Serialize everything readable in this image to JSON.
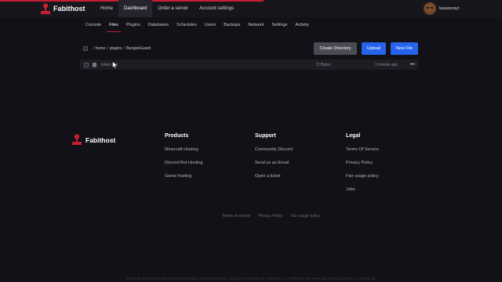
{
  "brand": {
    "name": "Fabithost"
  },
  "topnav": {
    "items": [
      {
        "label": "Home"
      },
      {
        "label": "Dashboard"
      },
      {
        "label": "Order a server"
      },
      {
        "label": "Account settings"
      }
    ],
    "active": "Dashboard"
  },
  "user": {
    "name": "kasaisorayt"
  },
  "subnav": {
    "items": [
      {
        "label": "Console"
      },
      {
        "label": "Files"
      },
      {
        "label": "Plugins"
      },
      {
        "label": "Databases"
      },
      {
        "label": "Schedules"
      },
      {
        "label": "Users"
      },
      {
        "label": "Backups"
      },
      {
        "label": "Network"
      },
      {
        "label": "Settings"
      },
      {
        "label": "Activity"
      }
    ],
    "active": "Files"
  },
  "filebar": {
    "breadcrumb": [
      "/ home",
      "plugins",
      "BungeeGuard"
    ],
    "create_directory_label": "Create Directory",
    "upload_label": "Upload",
    "new_file_label": "New File"
  },
  "files": [
    {
      "name": "token.yml",
      "size": "72 Bytes",
      "modified": "1 minute ago",
      "menu": "•••"
    }
  ],
  "footer": {
    "brand": "Fabithost",
    "products": {
      "title": "Products",
      "links": [
        "Minecraft Hosting",
        "Discord Bot Hosting",
        "Game hosting"
      ]
    },
    "support": {
      "title": "Support",
      "links": [
        "Community Discord",
        "Send us an Email",
        "Open a ticket"
      ]
    },
    "legal": {
      "title": "Legal",
      "links": [
        "Terms Of Service",
        "Privacy Policy",
        "Fair usage policy",
        "Jobs"
      ]
    },
    "bottom_links": [
      "Terms of service",
      "Privacy Policy",
      "Fair usage policy"
    ],
    "disclaimer": "Minecraft and all associated Minecraft images or trademarks are copyright of Mojang AB. Fabithost is not affiliated with Minecraft, Mojang Studios or Mojang AB."
  },
  "colors": {
    "accent": "#c81e32",
    "primary_button": "#2563eb",
    "background": "#121117"
  }
}
